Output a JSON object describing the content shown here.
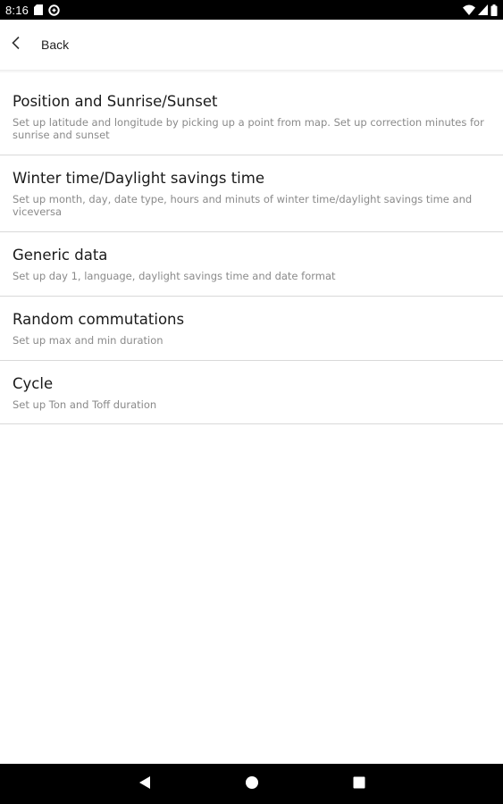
{
  "status_bar": {
    "time": "8:16",
    "left_icons": [
      "sd-card-icon",
      "data-saver-icon"
    ],
    "right_icons": [
      "wifi-icon",
      "cell-signal-icon",
      "battery-icon"
    ]
  },
  "app_bar": {
    "back_label": "Back",
    "back_icon": "chevron-left-icon"
  },
  "settings_items": [
    {
      "title": "Position and Sunrise/Sunset",
      "description": "Set up latitude and longitude by picking up a point from map. Set up correction minutes for sunrise and sunset"
    },
    {
      "title": "Winter time/Daylight savings time",
      "description": "Set up month, day, date type, hours and minuts of winter time/daylight savings time and viceversa"
    },
    {
      "title": "Generic data",
      "description": "Set up day 1, language, daylight savings time and date format"
    },
    {
      "title": "Random commutations",
      "description": "Set up max and min duration"
    },
    {
      "title": "Cycle",
      "description": "Set up Ton and Toff duration"
    }
  ],
  "nav_bar": {
    "buttons": [
      "back-triangle-icon",
      "home-circle-icon",
      "recents-square-icon"
    ]
  },
  "colors": {
    "status_bar_bg": "#000000",
    "nav_bar_bg": "#000000",
    "title_text": "#1a1a1a",
    "description_text": "#8a8a8a",
    "divider": "#d9d9d9"
  }
}
